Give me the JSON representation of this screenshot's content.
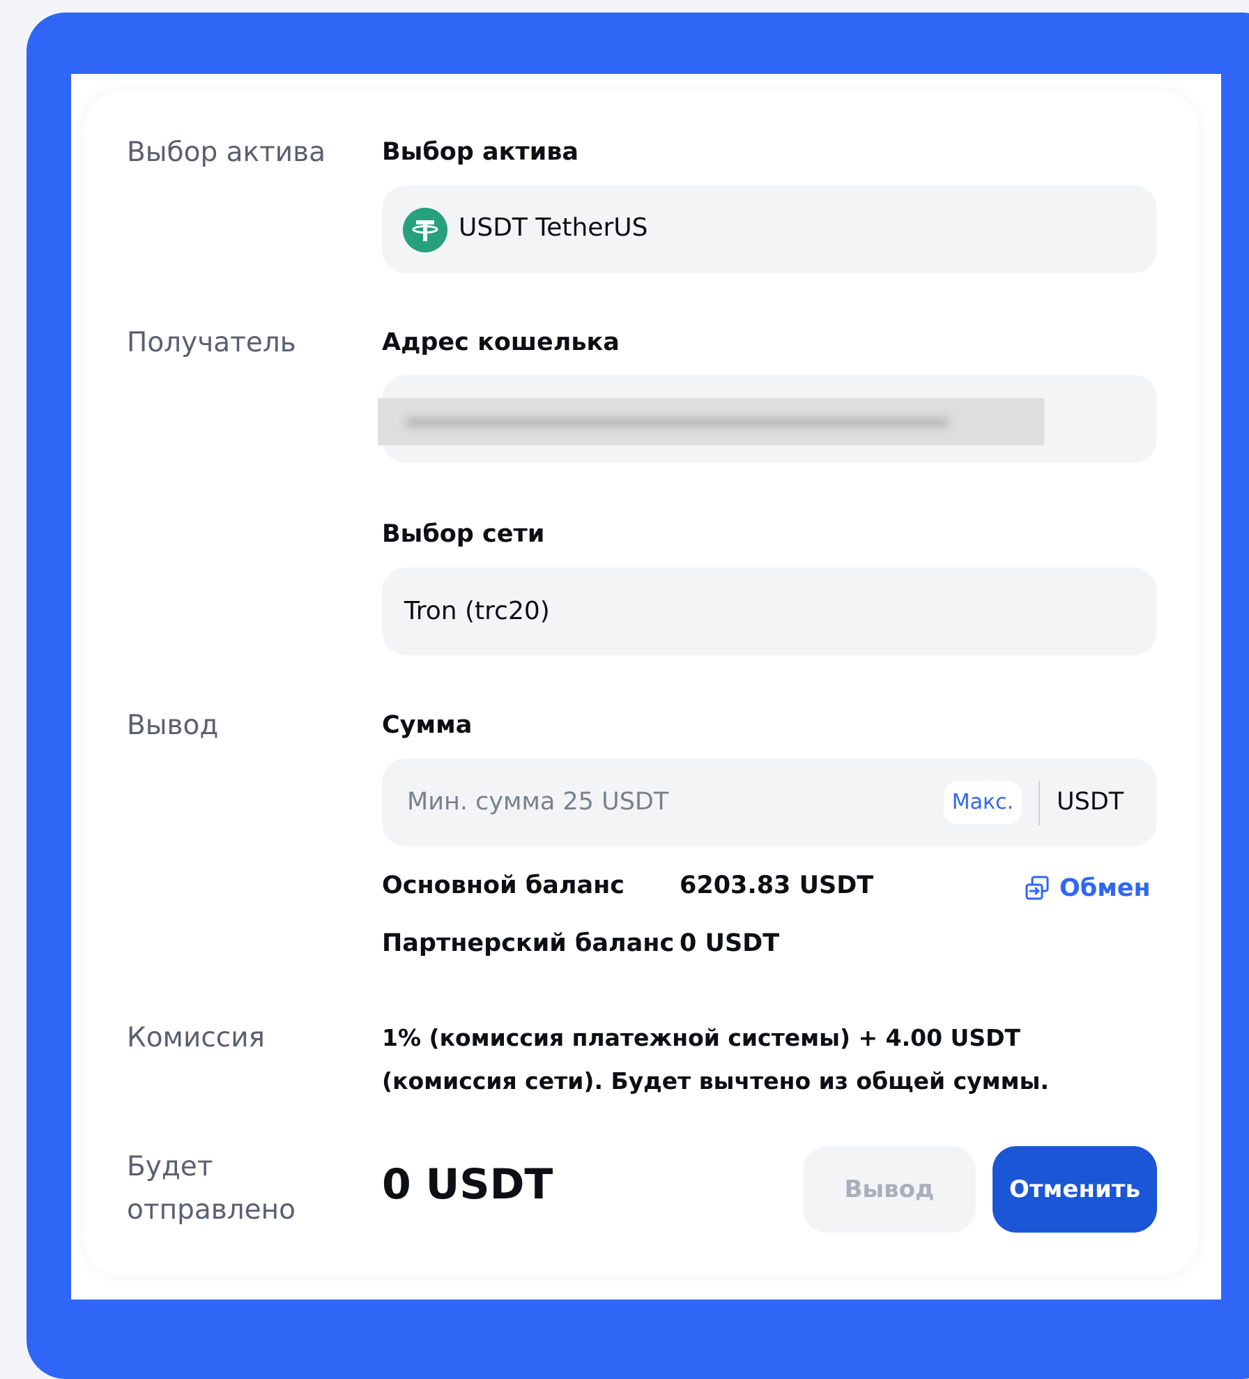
{
  "sections": {
    "asset": "Выбор актива",
    "recipient": "Получатель",
    "withdraw": "Вывод",
    "commission": "Комиссия",
    "will_send": "Будет отправлено"
  },
  "fields": {
    "asset_label": "Выбор актива",
    "asset_value": "USDT TetherUS",
    "asset_icon": "tether-icon",
    "wallet_label": "Адрес кошелька",
    "network_label": "Выбор сети",
    "network_value": "Tron (trc20)",
    "amount_label": "Сумма",
    "amount_placeholder": "Мин. сумма 25 USDT",
    "max_label": "Макс.",
    "currency": "USDT"
  },
  "balances": {
    "main_label": "Основной баланс",
    "main_value": "6203.83 USDT",
    "partner_label": "Партнерский баланс",
    "partner_value": "0 USDT",
    "exchange_label": "Обмен"
  },
  "commission_text": "1% (комиссия платежной системы) + 4.00 USDT (комиссия сети). Будет вычтено из общей суммы.",
  "total": "0 USDT",
  "buttons": {
    "withdraw": "Вывод",
    "cancel": "Отменить"
  },
  "colors": {
    "frame": "#2f66f5",
    "accent": "#2f66f5",
    "primary_button": "#1b56d6",
    "tether": "#26a17b"
  }
}
